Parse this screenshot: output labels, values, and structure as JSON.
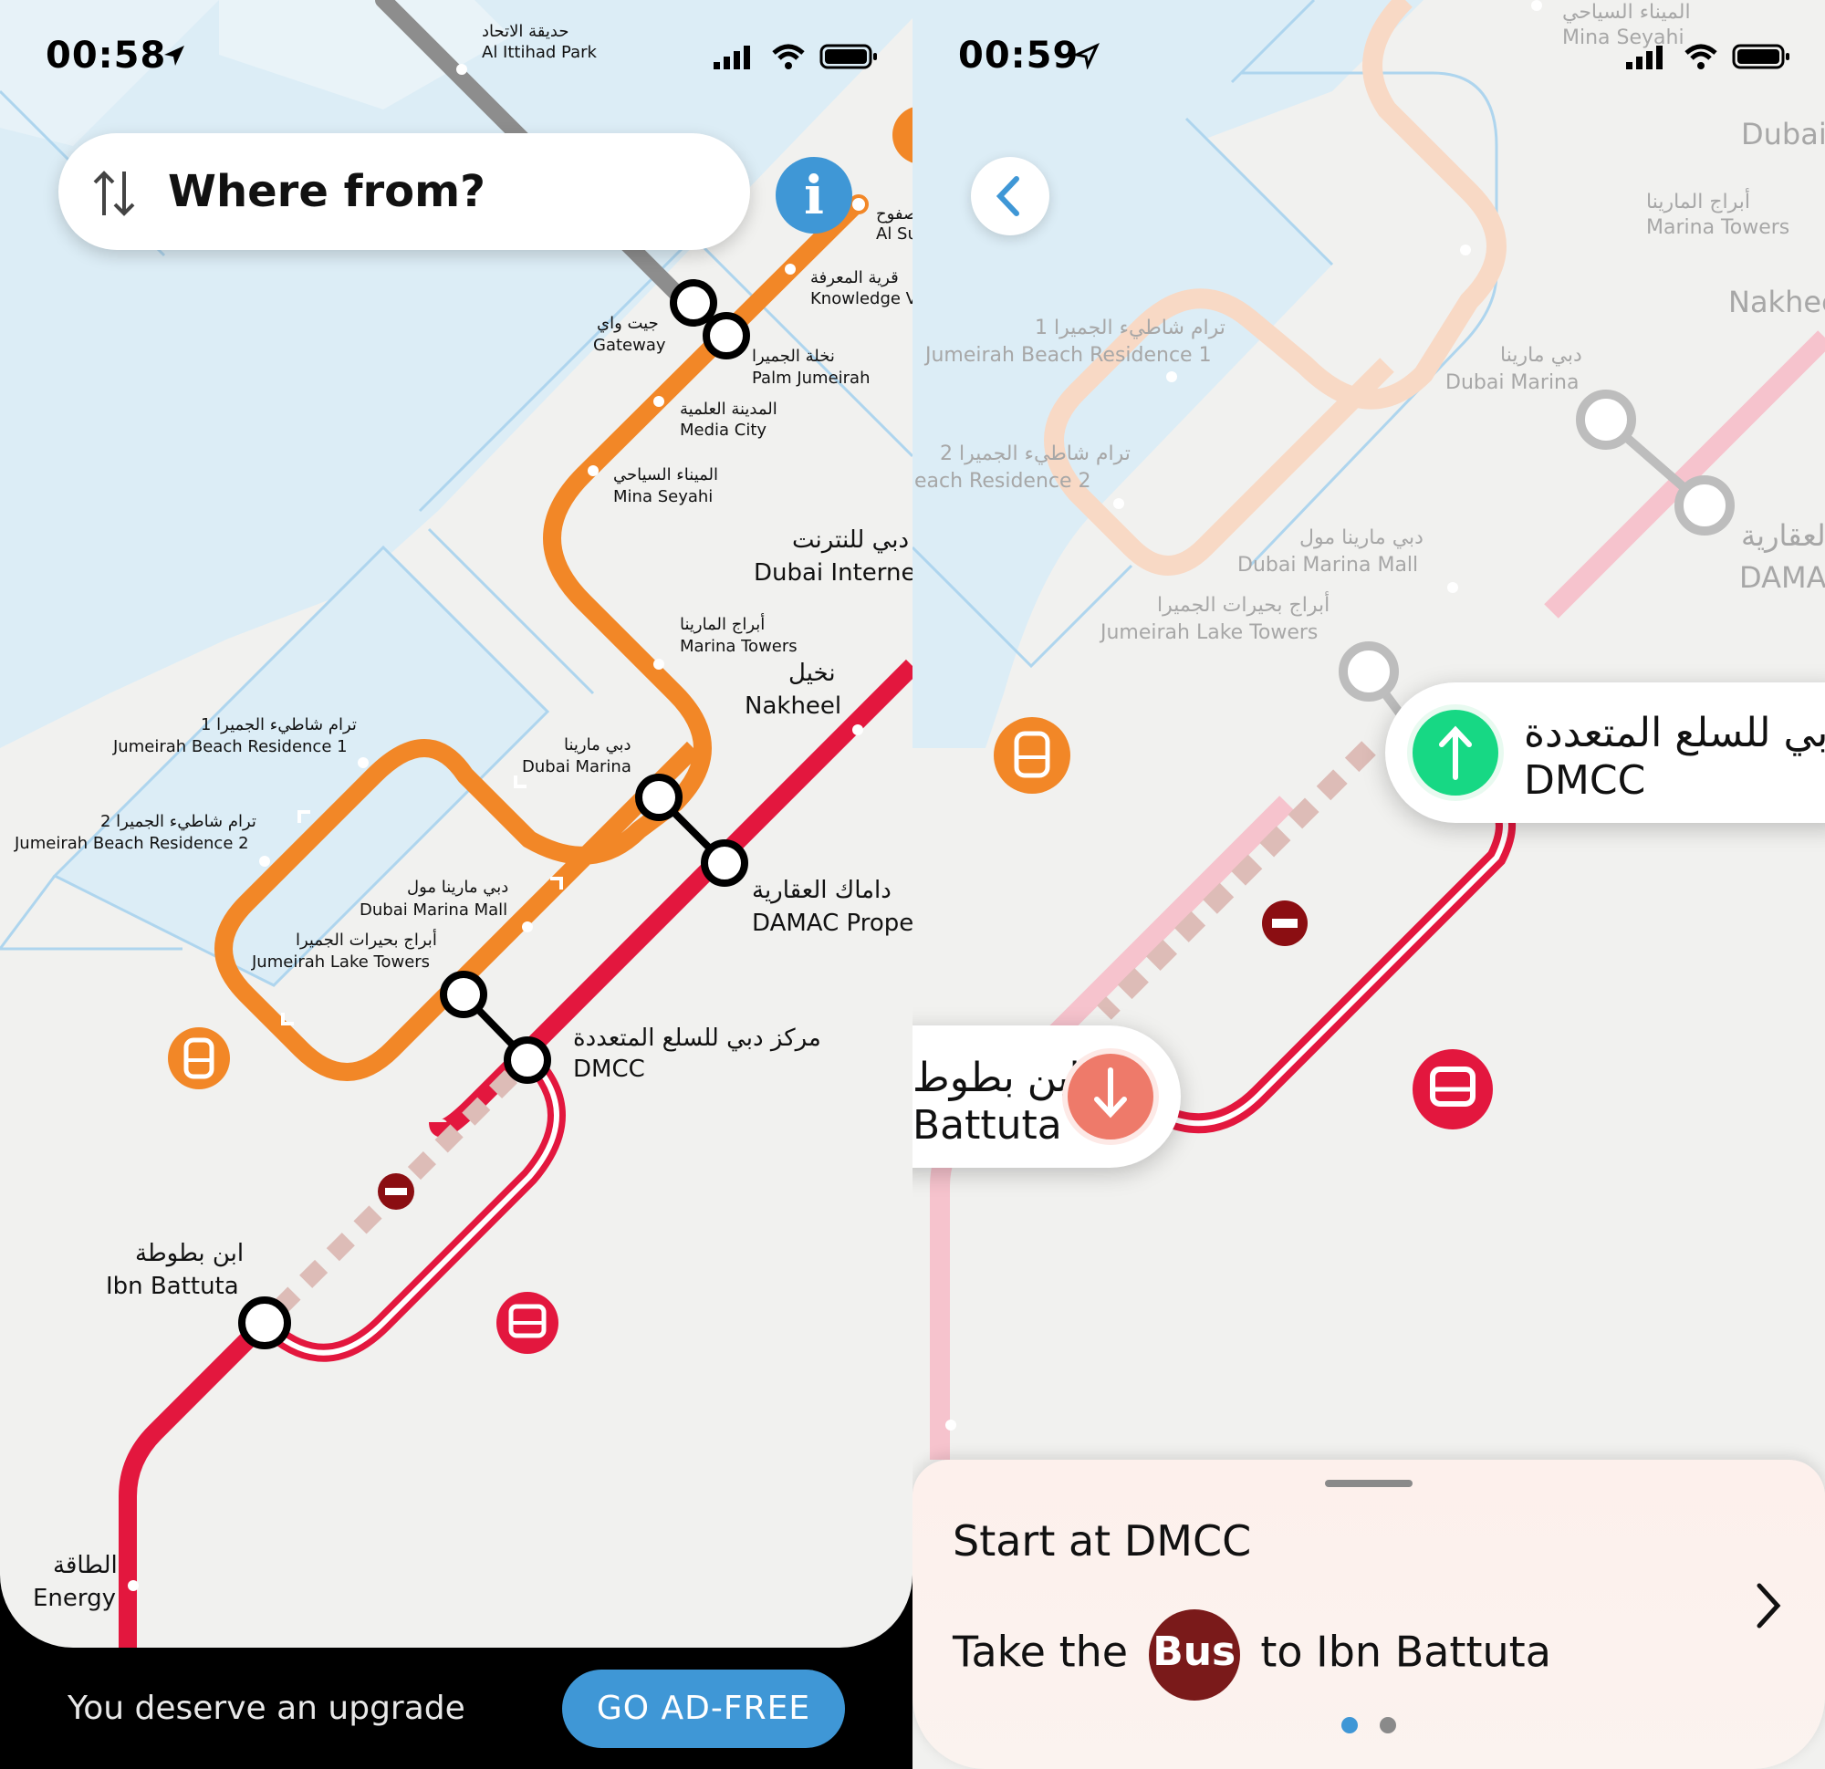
{
  "left_screen": {
    "status_time": "00:58",
    "search_placeholder": "Where from?",
    "info_icon": "i",
    "stations": {
      "al_ittihad_park_ar": "حديقة الاتحاد",
      "al_ittihad_park_en": "Al Ittihad Park",
      "al_sufouh_ar": "صفوح",
      "al_sufouh_en": "Al Su",
      "knowledge_ar": "قرية المعرفة",
      "knowledge_en": "Knowledge V",
      "gateway_ar": "جيت واي",
      "gateway_en": "Gateway",
      "palm_ar": "نخلة الجميرا",
      "palm_en": "Palm Jumeirah",
      "media_city_ar": "المدينة العلمية",
      "media_city_en": "Media City",
      "mina_seyahi_ar": "الميناء السياحي",
      "mina_seyahi_en": "Mina Seyahi",
      "internet_city_ar": "دبي للنترنت",
      "internet_city_en": "Dubai Interne",
      "marina_towers_ar": "أبراج المارينا",
      "marina_towers_en": "Marina Towers",
      "nakheel_ar": "نخيل",
      "nakheel_en": "Nakheel",
      "jbr1_ar": "ترام شاطيء الجميرا 1",
      "jbr1_en": "Jumeirah Beach Residence 1",
      "dubai_marina_ar": "دبي مارينا",
      "dubai_marina_en": "Dubai Marina",
      "jbr2_ar": "ترام شاطيء الجميرا 2",
      "jbr2_en": "Jumeirah Beach Residence 2",
      "marina_mall_ar": "دبي مارينا مول",
      "marina_mall_en": "Dubai Marina Mall",
      "damac_ar": "داماك العقارية",
      "damac_en": "DAMAC Prope",
      "jlt_ar": "أبراج بحيرات الجميرا",
      "jlt_en": "Jumeirah Lake Towers",
      "dmcc_ar": "مركز دبي للسلع المتعددة",
      "dmcc_en": "DMCC",
      "ibn_battuta_ar": "ابن بطوطة",
      "ibn_battuta_en": "Ibn Battuta",
      "energy_ar": "الطاقة",
      "energy_en": "Energy"
    },
    "ad_text": "You deserve an upgrade",
    "ad_button": "GO AD-FREE"
  },
  "right_screen": {
    "status_time": "00:59",
    "faded_labels": {
      "mina_seyahi_ar": "الميناء السياحي",
      "mina_seyahi_en": "Mina Seyahi",
      "dubai_frag": "Dubai",
      "marina_towers_ar": "أبراج المارينا",
      "marina_towers_en": "Marina Towers",
      "nakheel_frag": "Nakhee",
      "jbr1_ar": "ترام شاطيء الجميرا 1",
      "jbr1_en": "Jumeirah Beach Residence 1",
      "dubai_marina_ar": "دبي مارينا",
      "dubai_marina_en": "Dubai Marina",
      "jbr2_ar": "ترام شاطيء الجميرا 2",
      "jbr2_en": "each Residence 2",
      "damac_ar": "العقارية",
      "damac_en": "DAMA",
      "marina_mall_ar": "دبي مارينا مول",
      "marina_mall_en": "Dubai Marina Mall",
      "jlt_ar": "أبراج بحيرات الجميرا",
      "jlt_en": "Jumeirah Lake Towers"
    },
    "start_callout": {
      "ar": "دبي للسلع المتعددة",
      "en": "DMCC"
    },
    "end_callout": {
      "ar": "ابن بطوط",
      "en": "Battuta"
    },
    "sheet": {
      "line1": "Start at DMCC",
      "line2_prefix": "Take the",
      "mode": "Bus",
      "line2_suffix": "to Ibn Battuta"
    },
    "page_indicator": {
      "pages": 2,
      "current": 1
    }
  },
  "colors": {
    "water": "#dcedf6",
    "land": "#f1f1ef",
    "tram_line": "#f28727",
    "red_line": "#e3173e",
    "info_blue": "#3f97d6",
    "board_green": "#17d884",
    "alight_salmon": "#ee7a6a",
    "bus_maroon": "#7a1a1a",
    "closed_maroon": "#8b0e12"
  },
  "icons": [
    "location-arrow-icon",
    "signal-icon",
    "wifi-icon",
    "battery-icon",
    "swap-vertical-icon",
    "info-icon",
    "tram-icon",
    "bus-icon",
    "no-entry-icon",
    "back-chevron-icon",
    "board-arrow-icon",
    "alight-arrow-icon",
    "chevron-right-icon"
  ]
}
